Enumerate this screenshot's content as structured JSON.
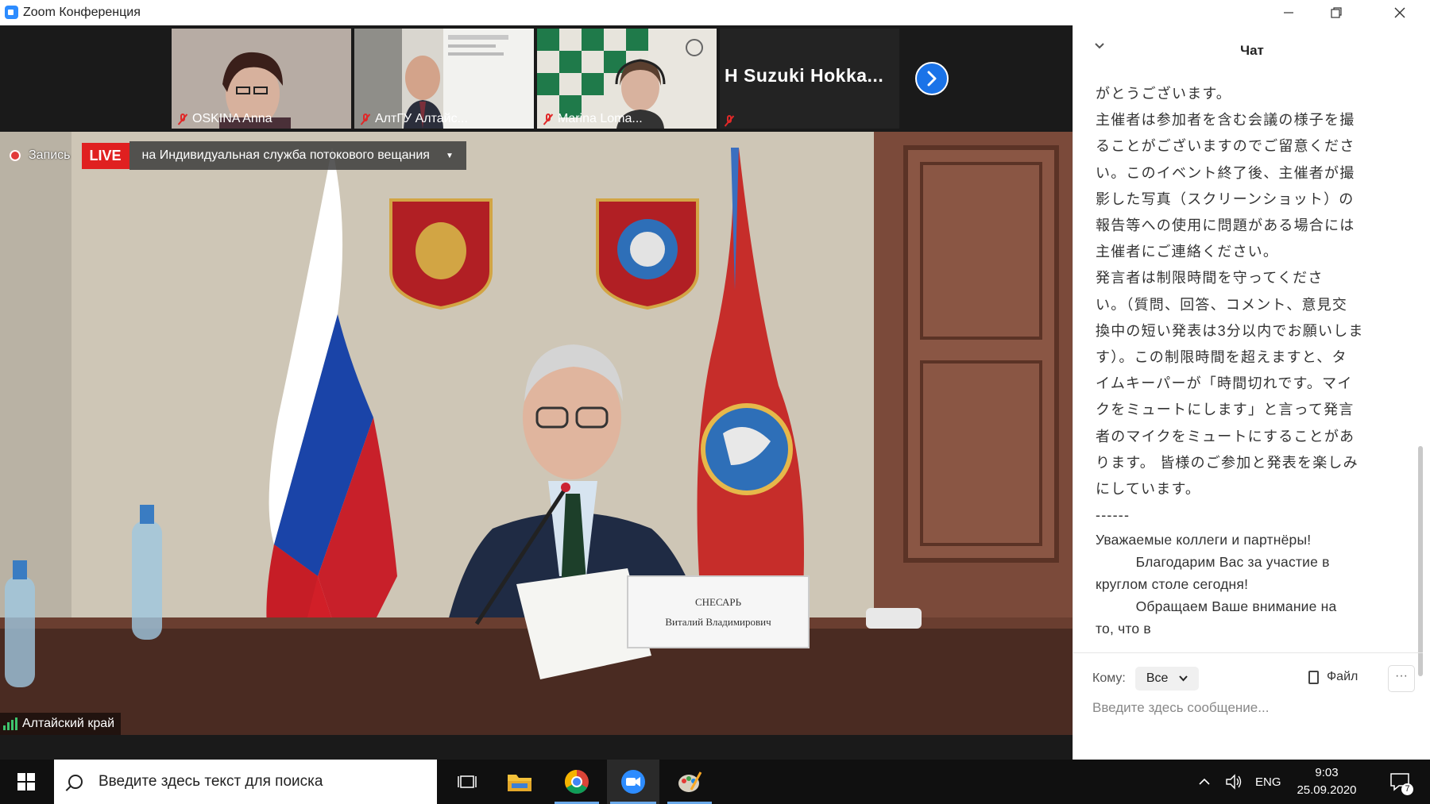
{
  "titlebar": {
    "title": "Zoom Конференция",
    "minimize_icon": "minimize-icon",
    "restore_icon": "restore-icon",
    "close_icon": "close-icon"
  },
  "participants": [
    {
      "name": "OSKINA Anna",
      "muted": true
    },
    {
      "name": "АлтГУ Алтайс...",
      "muted": true
    },
    {
      "name": "Marina Loma...",
      "muted": true
    },
    {
      "name": "H Suzuki Hokka...",
      "muted": true
    }
  ],
  "recording": {
    "label": "Запись",
    "live": "LIVE",
    "stream": "на Индивидуальная служба потокового вещания"
  },
  "main_video": {
    "label": "Алтайский край",
    "nameplate_line1": "СНЕСАРЬ",
    "nameplate_line2": "Виталий Владимирович"
  },
  "chat": {
    "title": "Чат",
    "jp_lines": [
      "がとうございます。",
      "主催者は参加者を含む会議の様子を撮",
      "ることがございますのでご留意くださ",
      "い。このイベント終了後、主催者が撮",
      "影した写真（スクリーンショット）の",
      "報告等への使用に問題がある場合には",
      "主催者にご連絡ください。",
      "発言者は制限時間を守ってくださ",
      "い。（質問、回答、コメント、意見交",
      "換中の短い発表は3分以内でお願いしま",
      "す）。この制限時間を超えますと、タ",
      "イムキーパーが「時間切れです。マイ",
      "クをミュートにします」と言って発言",
      "者のマイクをミュートにすることがあ",
      "ります。 皆様のご参加と発表を楽しみ",
      "にしています。",
      "------"
    ],
    "ru_lines": [
      "Уважаемые коллеги и партнёры!",
      "          Благодарим Вас за участие в",
      "круглом столе сегодня!",
      "          Обращаем Ваше внимание на",
      "то, что в"
    ],
    "to_label": "Кому:",
    "to_value": "Все",
    "file_label": "Файл",
    "more_label": "···",
    "input_placeholder": "Введите здесь сообщение..."
  },
  "taskbar": {
    "search_placeholder": "Введите здесь текст для поиска",
    "lang": "ENG",
    "time": "9:03",
    "date": "25.09.2020",
    "notifications": "7"
  },
  "colors": {
    "accent": "#2d8cff",
    "live": "#e02020",
    "muted": "#e02828",
    "stage": "#1a1a1a"
  }
}
